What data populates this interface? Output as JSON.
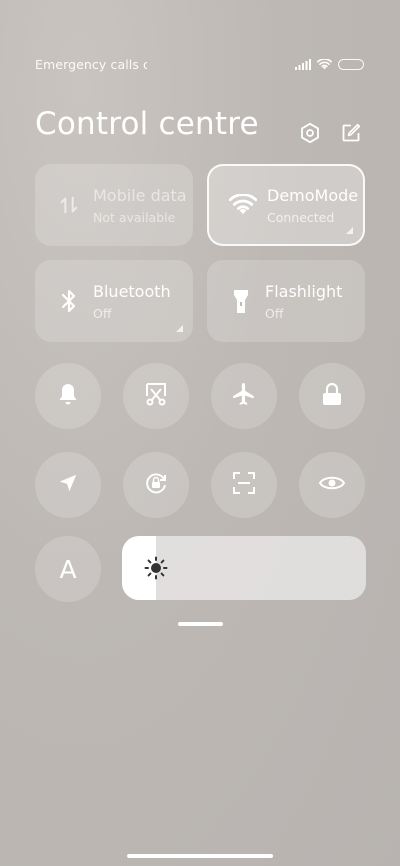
{
  "status_bar": {
    "carrier": "Emergency calls o",
    "icons": [
      "signal-icon",
      "wifi-icon",
      "battery-icon"
    ]
  },
  "header": {
    "title": "Control centre",
    "icons": [
      "settings-icon",
      "edit-icon"
    ]
  },
  "tiles": [
    {
      "name": "mobile-data",
      "label": "Mobile data",
      "sub": "Not available",
      "state": "disabled",
      "icon": "mobile-data-icon"
    },
    {
      "name": "wifi",
      "label": "DemoMode",
      "sub": "Connected",
      "state": "active",
      "icon": "wifi-icon"
    },
    {
      "name": "bluetooth",
      "label": "Bluetooth",
      "sub": "Off",
      "state": "off",
      "icon": "bluetooth-icon"
    },
    {
      "name": "flashlight",
      "label": "Flashlight",
      "sub": "Off",
      "state": "off",
      "icon": "flashlight-icon"
    }
  ],
  "toggles": [
    "bell-icon",
    "screenshot-icon",
    "airplane-icon",
    "lock-icon",
    "location-icon",
    "rotation-lock-icon",
    "scanner-icon",
    "reading-mode-icon"
  ],
  "auto_brightness_label": "A",
  "brightness": {
    "level": 0.14,
    "icon": "sun-icon"
  },
  "colors": {
    "active_border": "#ffffff",
    "tile_bg": "rgba(255,255,255,0.18)"
  }
}
